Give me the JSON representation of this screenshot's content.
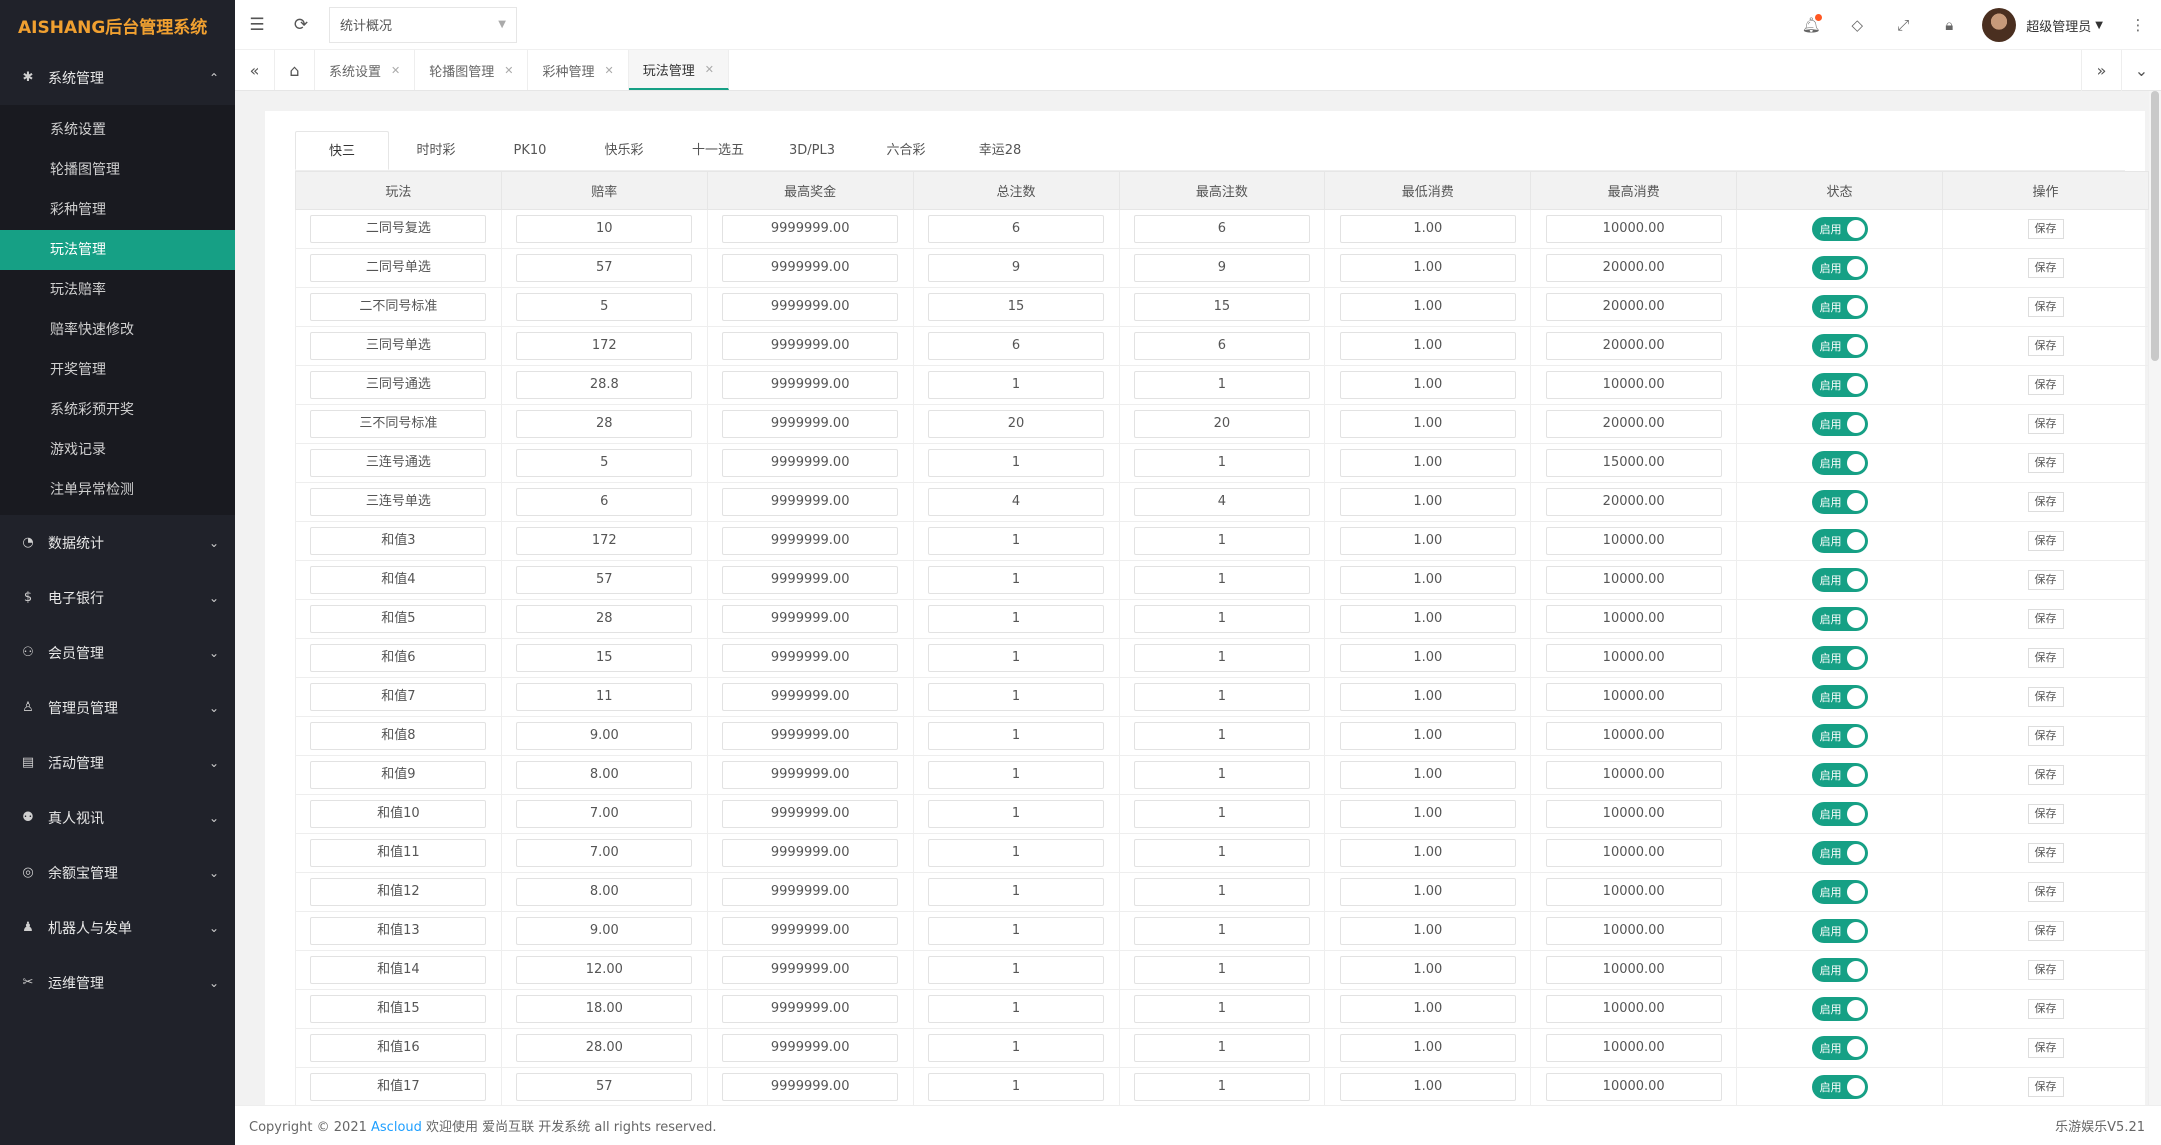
{
  "app": {
    "logo_text": "AISHANG后台管理系统"
  },
  "sidebar": {
    "groups": [
      {
        "label": "系统管理",
        "icon": "gear-icon",
        "expanded": true
      },
      {
        "label": "数据统计",
        "icon": "dashboard-icon"
      },
      {
        "label": "电子银行",
        "icon": "bank-icon"
      },
      {
        "label": "会员管理",
        "icon": "users-icon"
      },
      {
        "label": "管理员管理",
        "icon": "user-icon"
      },
      {
        "label": "活动管理",
        "icon": "calendar-icon"
      },
      {
        "label": "真人视讯",
        "icon": "group-icon"
      },
      {
        "label": "余额宝管理",
        "icon": "coin-icon"
      },
      {
        "label": "机器人与发单",
        "icon": "robot-icon"
      },
      {
        "label": "运维管理",
        "icon": "tools-icon"
      }
    ],
    "sub_items": [
      "系统设置",
      "轮播图管理",
      "彩种管理",
      "玩法管理",
      "玩法赔率",
      "赔率快速修改",
      "开奖管理",
      "系统彩预开奖",
      "游戏记录",
      "注单异常检测"
    ],
    "active_sub": "玩法管理"
  },
  "topbar": {
    "select_value": "统计概况",
    "user_name": "超级管理员"
  },
  "page_tabs": [
    "系统设置",
    "轮播图管理",
    "彩种管理",
    "玩法管理"
  ],
  "active_page_tab": "玩法管理",
  "lottery_tabs": [
    "快三",
    "时时彩",
    "PK10",
    "快乐彩",
    "十一选五",
    "3D/PL3",
    "六合彩",
    "幸运28"
  ],
  "active_lottery_tab": "快三",
  "table": {
    "headers": [
      "玩法",
      "赔率",
      "最高奖金",
      "总注数",
      "最高注数",
      "最低消费",
      "最高消费",
      "状态",
      "操作"
    ],
    "status_label": "启用",
    "action_label": "保存",
    "rows": [
      [
        "二同号复选",
        "10",
        "9999999.00",
        "6",
        "6",
        "1.00",
        "10000.00"
      ],
      [
        "二同号单选",
        "57",
        "9999999.00",
        "9",
        "9",
        "1.00",
        "20000.00"
      ],
      [
        "二不同号标准",
        "5",
        "9999999.00",
        "15",
        "15",
        "1.00",
        "20000.00"
      ],
      [
        "三同号单选",
        "172",
        "9999999.00",
        "6",
        "6",
        "1.00",
        "20000.00"
      ],
      [
        "三同号通选",
        "28.8",
        "9999999.00",
        "1",
        "1",
        "1.00",
        "10000.00"
      ],
      [
        "三不同号标准",
        "28",
        "9999999.00",
        "20",
        "20",
        "1.00",
        "20000.00"
      ],
      [
        "三连号通选",
        "5",
        "9999999.00",
        "1",
        "1",
        "1.00",
        "15000.00"
      ],
      [
        "三连号单选",
        "6",
        "9999999.00",
        "4",
        "4",
        "1.00",
        "20000.00"
      ],
      [
        "和值3",
        "172",
        "9999999.00",
        "1",
        "1",
        "1.00",
        "10000.00"
      ],
      [
        "和值4",
        "57",
        "9999999.00",
        "1",
        "1",
        "1.00",
        "10000.00"
      ],
      [
        "和值5",
        "28",
        "9999999.00",
        "1",
        "1",
        "1.00",
        "10000.00"
      ],
      [
        "和值6",
        "15",
        "9999999.00",
        "1",
        "1",
        "1.00",
        "10000.00"
      ],
      [
        "和值7",
        "11",
        "9999999.00",
        "1",
        "1",
        "1.00",
        "10000.00"
      ],
      [
        "和值8",
        "9.00",
        "9999999.00",
        "1",
        "1",
        "1.00",
        "10000.00"
      ],
      [
        "和值9",
        "8.00",
        "9999999.00",
        "1",
        "1",
        "1.00",
        "10000.00"
      ],
      [
        "和值10",
        "7.00",
        "9999999.00",
        "1",
        "1",
        "1.00",
        "10000.00"
      ],
      [
        "和值11",
        "7.00",
        "9999999.00",
        "1",
        "1",
        "1.00",
        "10000.00"
      ],
      [
        "和值12",
        "8.00",
        "9999999.00",
        "1",
        "1",
        "1.00",
        "10000.00"
      ],
      [
        "和值13",
        "9.00",
        "9999999.00",
        "1",
        "1",
        "1.00",
        "10000.00"
      ],
      [
        "和值14",
        "12.00",
        "9999999.00",
        "1",
        "1",
        "1.00",
        "10000.00"
      ],
      [
        "和值15",
        "18.00",
        "9999999.00",
        "1",
        "1",
        "1.00",
        "10000.00"
      ],
      [
        "和值16",
        "28.00",
        "9999999.00",
        "1",
        "1",
        "1.00",
        "10000.00"
      ],
      [
        "和值17",
        "57",
        "9999999.00",
        "1",
        "1",
        "1.00",
        "10000.00"
      ]
    ]
  },
  "footer": {
    "copyright_prefix": "Copyright © 2021",
    "brand_link": "Ascloud",
    "copyright_suffix": "欢迎使用 爱尚互联 开发系统 all rights reserved.",
    "version": "乐游娱乐V5.21"
  },
  "colors": {
    "accent": "#16a085",
    "sidebar_bg": "#20222a",
    "logo": "#f0a030"
  }
}
